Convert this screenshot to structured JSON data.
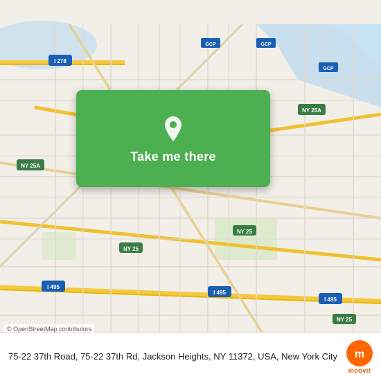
{
  "map": {
    "alt": "Street map of Jackson Heights, Queens, NY",
    "backgroundColor": "#f2efe9"
  },
  "locationCard": {
    "buttonLabel": "Take me there"
  },
  "attribution": {
    "text": "© OpenStreetMap contributors"
  },
  "bottomBar": {
    "address": "75-22 37th Road, 75-22 37th Rd, Jackson Heights,\nNY 11372, USA, New York City",
    "brandName": "moovit"
  }
}
